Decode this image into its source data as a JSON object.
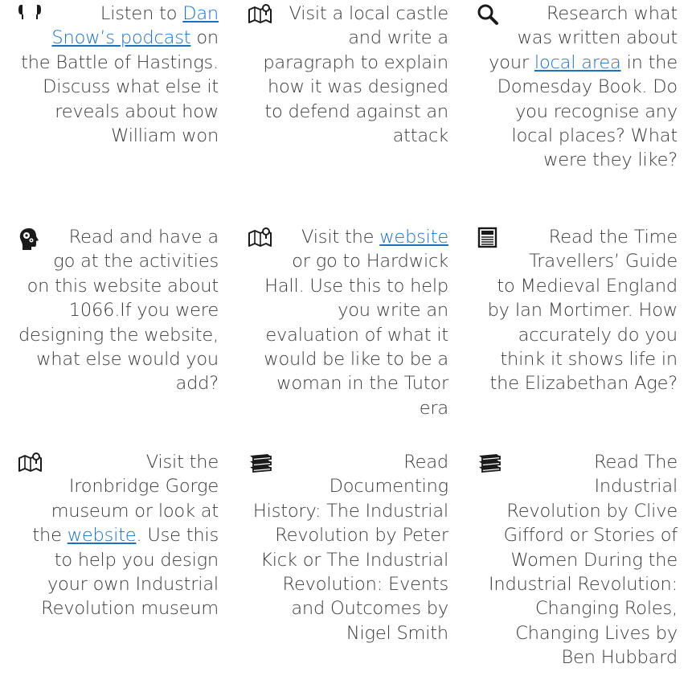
{
  "cards": [
    {
      "icon": "earphones-icon",
      "before": "Listen to ",
      "link": "Dan Snow’s podcast",
      "after": " on the Battle of Hastings. Discuss what else it reveals about how William won"
    },
    {
      "icon": "map-location-icon",
      "text": "Visit a local castle and write a paragraph to explain how it was designed to defend against an attack"
    },
    {
      "icon": "magnifier-icon",
      "before": "Research what was written about your ",
      "link": "local area",
      "after": " in the Domesday Book. Do you recognise any local places? What were they like?"
    },
    {
      "icon": "head-gears-icon",
      "text": "Read and have a go at the activities on this website about 1066.If you were designing the website, what else would you add?"
    },
    {
      "icon": "map-location-icon",
      "before": "Visit the ",
      "link": "website",
      "after": " or go to Hardwick Hall. Use this to help you write an evaluation of what it would be like to be a woman in the Tutor era"
    },
    {
      "icon": "newspaper-icon",
      "text": "Read the Time Travellers’ Guide to Medieval England by Ian Mortimer. How accurately do you think it shows life in the Elizabethan Age?"
    },
    {
      "icon": "map-location-icon",
      "before": "Visit the Ironbridge Gorge museum or look at the ",
      "link": "website",
      "after": ". Use this to help you design your own Industrial Revolution museum"
    },
    {
      "icon": "books-stack-icon",
      "text": "Read Documenting History: The Industrial Revolution by Peter Kick or The Industrial Revolution: Events and Outcomes by Nigel Smith"
    },
    {
      "icon": "books-stack-icon",
      "text": "Read The Industrial Revolution by Clive Gifford or Stories of Women During the Industrial Revolution: Changing Roles, Changing Lives by Ben Hubbard"
    }
  ],
  "colors": {
    "text": "#3a3a3a",
    "link": "#1d6fbf",
    "icon": "#1a1a1a"
  }
}
